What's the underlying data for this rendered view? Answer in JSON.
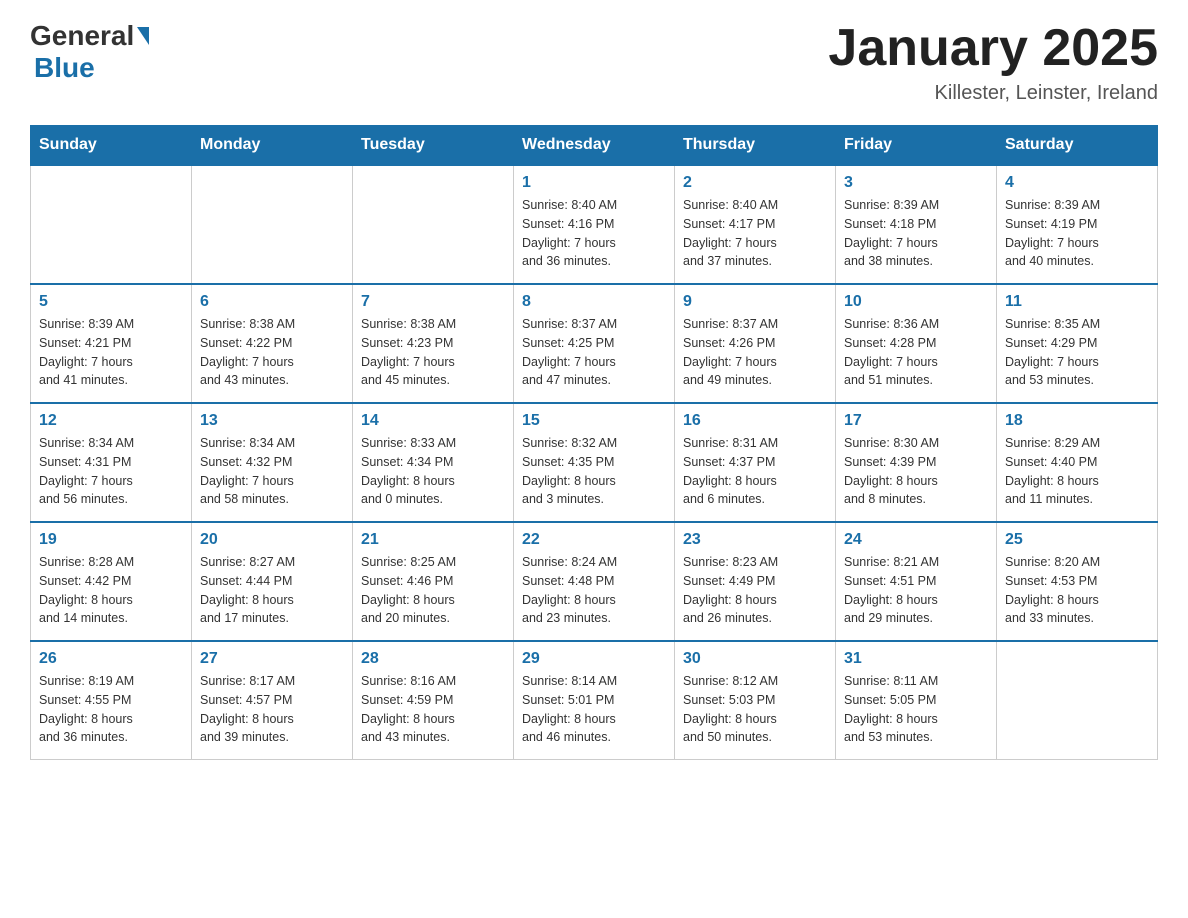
{
  "logo": {
    "general": "General",
    "blue": "Blue"
  },
  "title": "January 2025",
  "location": "Killester, Leinster, Ireland",
  "days_of_week": [
    "Sunday",
    "Monday",
    "Tuesday",
    "Wednesday",
    "Thursday",
    "Friday",
    "Saturday"
  ],
  "weeks": [
    [
      {
        "day": "",
        "info": ""
      },
      {
        "day": "",
        "info": ""
      },
      {
        "day": "",
        "info": ""
      },
      {
        "day": "1",
        "info": "Sunrise: 8:40 AM\nSunset: 4:16 PM\nDaylight: 7 hours\nand 36 minutes."
      },
      {
        "day": "2",
        "info": "Sunrise: 8:40 AM\nSunset: 4:17 PM\nDaylight: 7 hours\nand 37 minutes."
      },
      {
        "day": "3",
        "info": "Sunrise: 8:39 AM\nSunset: 4:18 PM\nDaylight: 7 hours\nand 38 minutes."
      },
      {
        "day": "4",
        "info": "Sunrise: 8:39 AM\nSunset: 4:19 PM\nDaylight: 7 hours\nand 40 minutes."
      }
    ],
    [
      {
        "day": "5",
        "info": "Sunrise: 8:39 AM\nSunset: 4:21 PM\nDaylight: 7 hours\nand 41 minutes."
      },
      {
        "day": "6",
        "info": "Sunrise: 8:38 AM\nSunset: 4:22 PM\nDaylight: 7 hours\nand 43 minutes."
      },
      {
        "day": "7",
        "info": "Sunrise: 8:38 AM\nSunset: 4:23 PM\nDaylight: 7 hours\nand 45 minutes."
      },
      {
        "day": "8",
        "info": "Sunrise: 8:37 AM\nSunset: 4:25 PM\nDaylight: 7 hours\nand 47 minutes."
      },
      {
        "day": "9",
        "info": "Sunrise: 8:37 AM\nSunset: 4:26 PM\nDaylight: 7 hours\nand 49 minutes."
      },
      {
        "day": "10",
        "info": "Sunrise: 8:36 AM\nSunset: 4:28 PM\nDaylight: 7 hours\nand 51 minutes."
      },
      {
        "day": "11",
        "info": "Sunrise: 8:35 AM\nSunset: 4:29 PM\nDaylight: 7 hours\nand 53 minutes."
      }
    ],
    [
      {
        "day": "12",
        "info": "Sunrise: 8:34 AM\nSunset: 4:31 PM\nDaylight: 7 hours\nand 56 minutes."
      },
      {
        "day": "13",
        "info": "Sunrise: 8:34 AM\nSunset: 4:32 PM\nDaylight: 7 hours\nand 58 minutes."
      },
      {
        "day": "14",
        "info": "Sunrise: 8:33 AM\nSunset: 4:34 PM\nDaylight: 8 hours\nand 0 minutes."
      },
      {
        "day": "15",
        "info": "Sunrise: 8:32 AM\nSunset: 4:35 PM\nDaylight: 8 hours\nand 3 minutes."
      },
      {
        "day": "16",
        "info": "Sunrise: 8:31 AM\nSunset: 4:37 PM\nDaylight: 8 hours\nand 6 minutes."
      },
      {
        "day": "17",
        "info": "Sunrise: 8:30 AM\nSunset: 4:39 PM\nDaylight: 8 hours\nand 8 minutes."
      },
      {
        "day": "18",
        "info": "Sunrise: 8:29 AM\nSunset: 4:40 PM\nDaylight: 8 hours\nand 11 minutes."
      }
    ],
    [
      {
        "day": "19",
        "info": "Sunrise: 8:28 AM\nSunset: 4:42 PM\nDaylight: 8 hours\nand 14 minutes."
      },
      {
        "day": "20",
        "info": "Sunrise: 8:27 AM\nSunset: 4:44 PM\nDaylight: 8 hours\nand 17 minutes."
      },
      {
        "day": "21",
        "info": "Sunrise: 8:25 AM\nSunset: 4:46 PM\nDaylight: 8 hours\nand 20 minutes."
      },
      {
        "day": "22",
        "info": "Sunrise: 8:24 AM\nSunset: 4:48 PM\nDaylight: 8 hours\nand 23 minutes."
      },
      {
        "day": "23",
        "info": "Sunrise: 8:23 AM\nSunset: 4:49 PM\nDaylight: 8 hours\nand 26 minutes."
      },
      {
        "day": "24",
        "info": "Sunrise: 8:21 AM\nSunset: 4:51 PM\nDaylight: 8 hours\nand 29 minutes."
      },
      {
        "day": "25",
        "info": "Sunrise: 8:20 AM\nSunset: 4:53 PM\nDaylight: 8 hours\nand 33 minutes."
      }
    ],
    [
      {
        "day": "26",
        "info": "Sunrise: 8:19 AM\nSunset: 4:55 PM\nDaylight: 8 hours\nand 36 minutes."
      },
      {
        "day": "27",
        "info": "Sunrise: 8:17 AM\nSunset: 4:57 PM\nDaylight: 8 hours\nand 39 minutes."
      },
      {
        "day": "28",
        "info": "Sunrise: 8:16 AM\nSunset: 4:59 PM\nDaylight: 8 hours\nand 43 minutes."
      },
      {
        "day": "29",
        "info": "Sunrise: 8:14 AM\nSunset: 5:01 PM\nDaylight: 8 hours\nand 46 minutes."
      },
      {
        "day": "30",
        "info": "Sunrise: 8:12 AM\nSunset: 5:03 PM\nDaylight: 8 hours\nand 50 minutes."
      },
      {
        "day": "31",
        "info": "Sunrise: 8:11 AM\nSunset: 5:05 PM\nDaylight: 8 hours\nand 53 minutes."
      },
      {
        "day": "",
        "info": ""
      }
    ]
  ]
}
